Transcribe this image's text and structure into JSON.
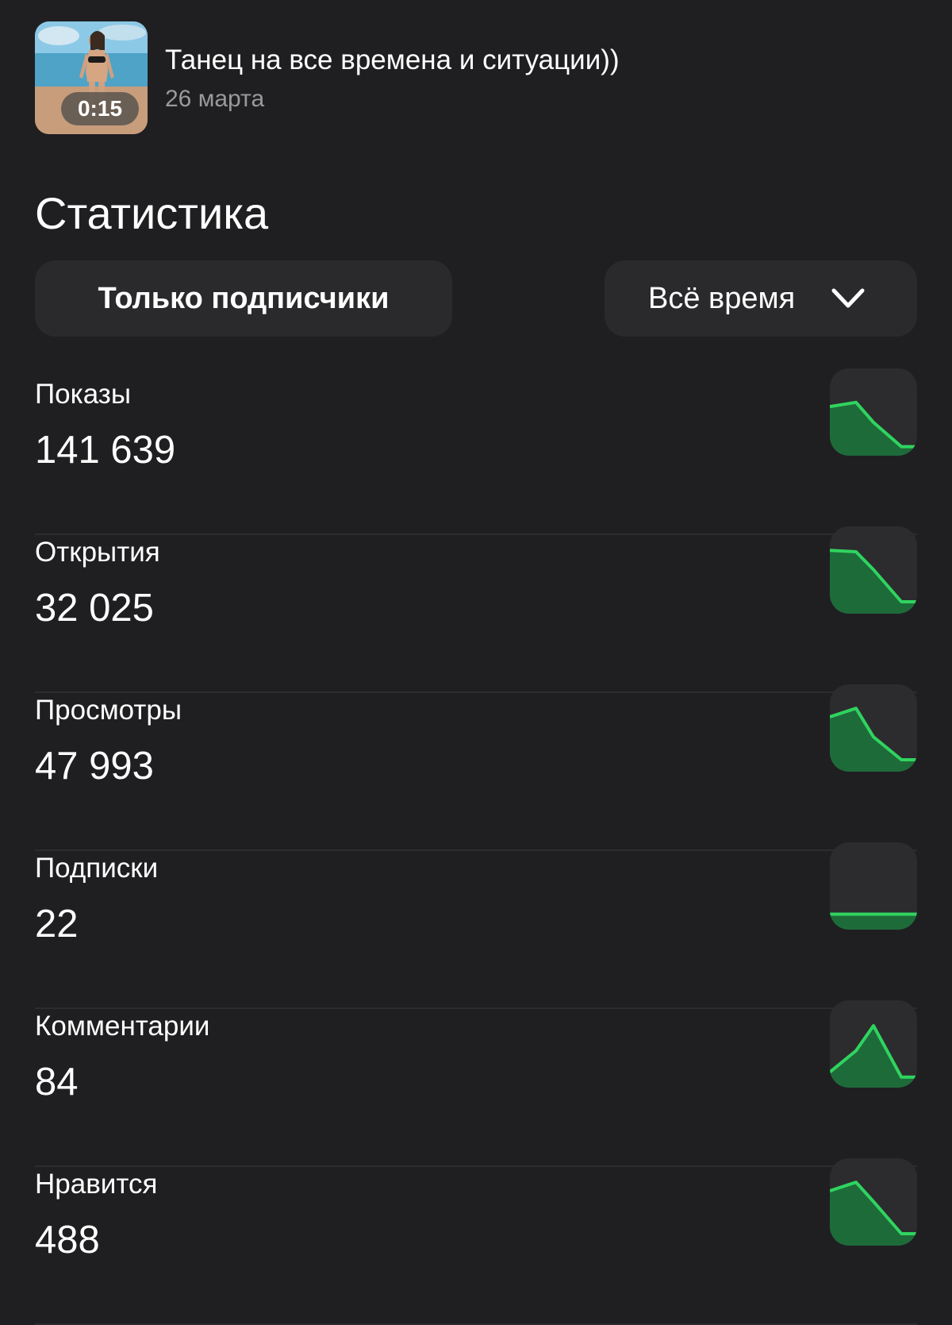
{
  "video": {
    "title": "Танец на все времена и ситуации))",
    "date": "26 марта",
    "duration": "0:15"
  },
  "section_title": "Статистика",
  "filters": {
    "audience_button_label": "Только подписчики",
    "period_selected": "Всё время"
  },
  "colors": {
    "background": "#1f1f21",
    "card": "#2a2a2c",
    "accent_line": "#2fd45f",
    "accent_fill": "#1e6b3a",
    "secondary_text": "#9a9a9d"
  },
  "stats": [
    {
      "key": "impressions",
      "label": "Показы",
      "value": "141 639",
      "trend": [
        0.62,
        0.68,
        0.4,
        0.06,
        0.06
      ]
    },
    {
      "key": "opens",
      "label": "Открытия",
      "value": "32 025",
      "trend": [
        0.82,
        0.8,
        0.55,
        0.1,
        0.1
      ]
    },
    {
      "key": "views",
      "label": "Просмотры",
      "value": "47 993",
      "trend": [
        0.7,
        0.82,
        0.42,
        0.1,
        0.1
      ]
    },
    {
      "key": "subscriptions",
      "label": "Подписки",
      "value": "22",
      "trend": [
        0.15,
        0.15,
        0.15,
        0.15,
        0.15
      ]
    },
    {
      "key": "comments",
      "label": "Комментарии",
      "value": "84",
      "trend": [
        0.15,
        0.45,
        0.8,
        0.08,
        0.08
      ]
    },
    {
      "key": "likes",
      "label": "Нравится",
      "value": "488",
      "trend": [
        0.7,
        0.82,
        0.55,
        0.1,
        0.1
      ]
    }
  ]
}
